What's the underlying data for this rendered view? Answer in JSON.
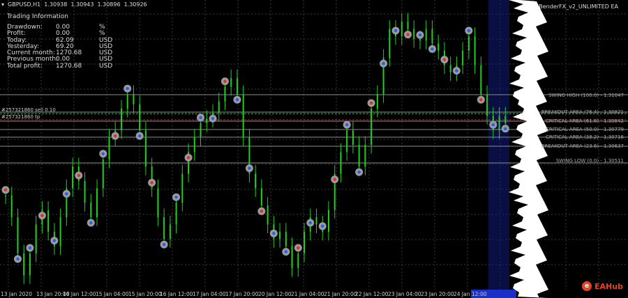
{
  "header": {
    "symbol": "GBPUSD,H1",
    "ohlc": [
      "1.30938",
      "1.30943",
      "1.30896",
      "1.30926"
    ]
  },
  "info": {
    "title": "Trading Information",
    "rows": [
      {
        "label": "Drawdown:",
        "value": "0.00",
        "unit": "%"
      },
      {
        "label": "Profit:",
        "value": "0.00",
        "unit": "%"
      },
      {
        "label": "Today:",
        "value": "62.09",
        "unit": "USD"
      },
      {
        "label": "Yesterday:",
        "value": "69.20",
        "unit": "USD"
      },
      {
        "label": "Current month:",
        "value": "1270.68",
        "unit": "USD"
      },
      {
        "label": "Previous month:",
        "value": "0.00",
        "unit": "USD"
      },
      {
        "label": "Total profit:",
        "value": "1270.68",
        "unit": "USD"
      }
    ]
  },
  "ea_name": "BenderFX_v2_UNLIMITED EA",
  "orders": [
    {
      "text": "#257321860 sell 0.10",
      "color": "#2e8b2e",
      "price": 1.30882
    },
    {
      "text": "#257321860 tp",
      "color": "#c81e1e",
      "price": 1.30818
    }
  ],
  "levels": [
    {
      "text": "SWING HIGH (100.0) - 1.31047",
      "price": 1.31047
    },
    {
      "text": "BREAKOUT AREA (76.4) - 1.30821",
      "price": 1.30821
    },
    {
      "text": "CRITICAL AREA (61.8) - 1.30842",
      "price": 1.30742
    },
    {
      "text": "CRITICAL AREA (50.0) - 1.30779",
      "price": 1.30679
    },
    {
      "text": "CRITICAL AREA (38.2) - 1.30716",
      "price": 1.30616
    },
    {
      "text": "BREAKOUT AREA (23.6) - 1.30637",
      "price": 1.30537
    },
    {
      "text": "SWING LOW (0.0) - 1.30511",
      "price": 1.30411
    }
  ],
  "xaxis": [
    "13 Jan 2020",
    "13 Jan 20:00",
    "14 Jan 12:00",
    "15 Jan 04:00",
    "15 Jan 20:00",
    "16 Jan 12:00",
    "17 Jan 04:00",
    "17 Jan 20:00",
    "20 Jan 12:00",
    "21 Jan 04:00",
    "21 Jan 20:00",
    "22 Jan 12:00",
    "23 Jan 04:00",
    "23 Jan 20:00",
    "24 Jan 12:00"
  ],
  "brand": {
    "logo": "e",
    "text": "EAHub"
  },
  "colors": {
    "bull": "#1fd11f",
    "bear": "#1fd11f",
    "grid": "#3a3a3a",
    "level": "#8e8e8e",
    "buy_marker": "#1e5cff",
    "sell_marker": "#e52a2a",
    "marker_ring": "#9a9a9a",
    "session_band": "#1420a0"
  },
  "chart_data": {
    "type": "candlestick",
    "title": "GBPUSD,H1",
    "ylim": [
      1.296,
      1.316
    ],
    "closes": [
      1.3025,
      1.301,
      1.2985,
      1.297,
      1.2985,
      1.3005,
      1.3015,
      1.3,
      1.299,
      1.301,
      1.303,
      1.3045,
      1.3035,
      1.302,
      1.301,
      1.303,
      1.305,
      1.3065,
      1.307,
      1.3085,
      1.3095,
      1.3088,
      1.307,
      1.3045,
      1.303,
      1.301,
      1.2995,
      1.3005,
      1.302,
      1.304,
      1.3055,
      1.3065,
      1.3075,
      1.3078,
      1.3082,
      1.309,
      1.31,
      1.3106,
      1.3095,
      1.3065,
      1.304,
      1.303,
      1.3018,
      1.3005,
      1.2995,
      1.3,
      1.299,
      1.2975,
      1.2985,
      1.3,
      1.301,
      1.3005,
      1.3,
      1.3015,
      1.304,
      1.3055,
      1.307,
      1.306,
      1.3045,
      1.306,
      1.3085,
      1.3095,
      1.312,
      1.314,
      1.3135,
      1.3145,
      1.314,
      1.3133,
      1.3132,
      1.314,
      1.313,
      1.3125,
      1.3115,
      1.311,
      1.3115,
      1.3125,
      1.3135,
      1.3115,
      1.3095,
      1.308,
      1.307,
      1.308,
      1.3075
    ]
  }
}
